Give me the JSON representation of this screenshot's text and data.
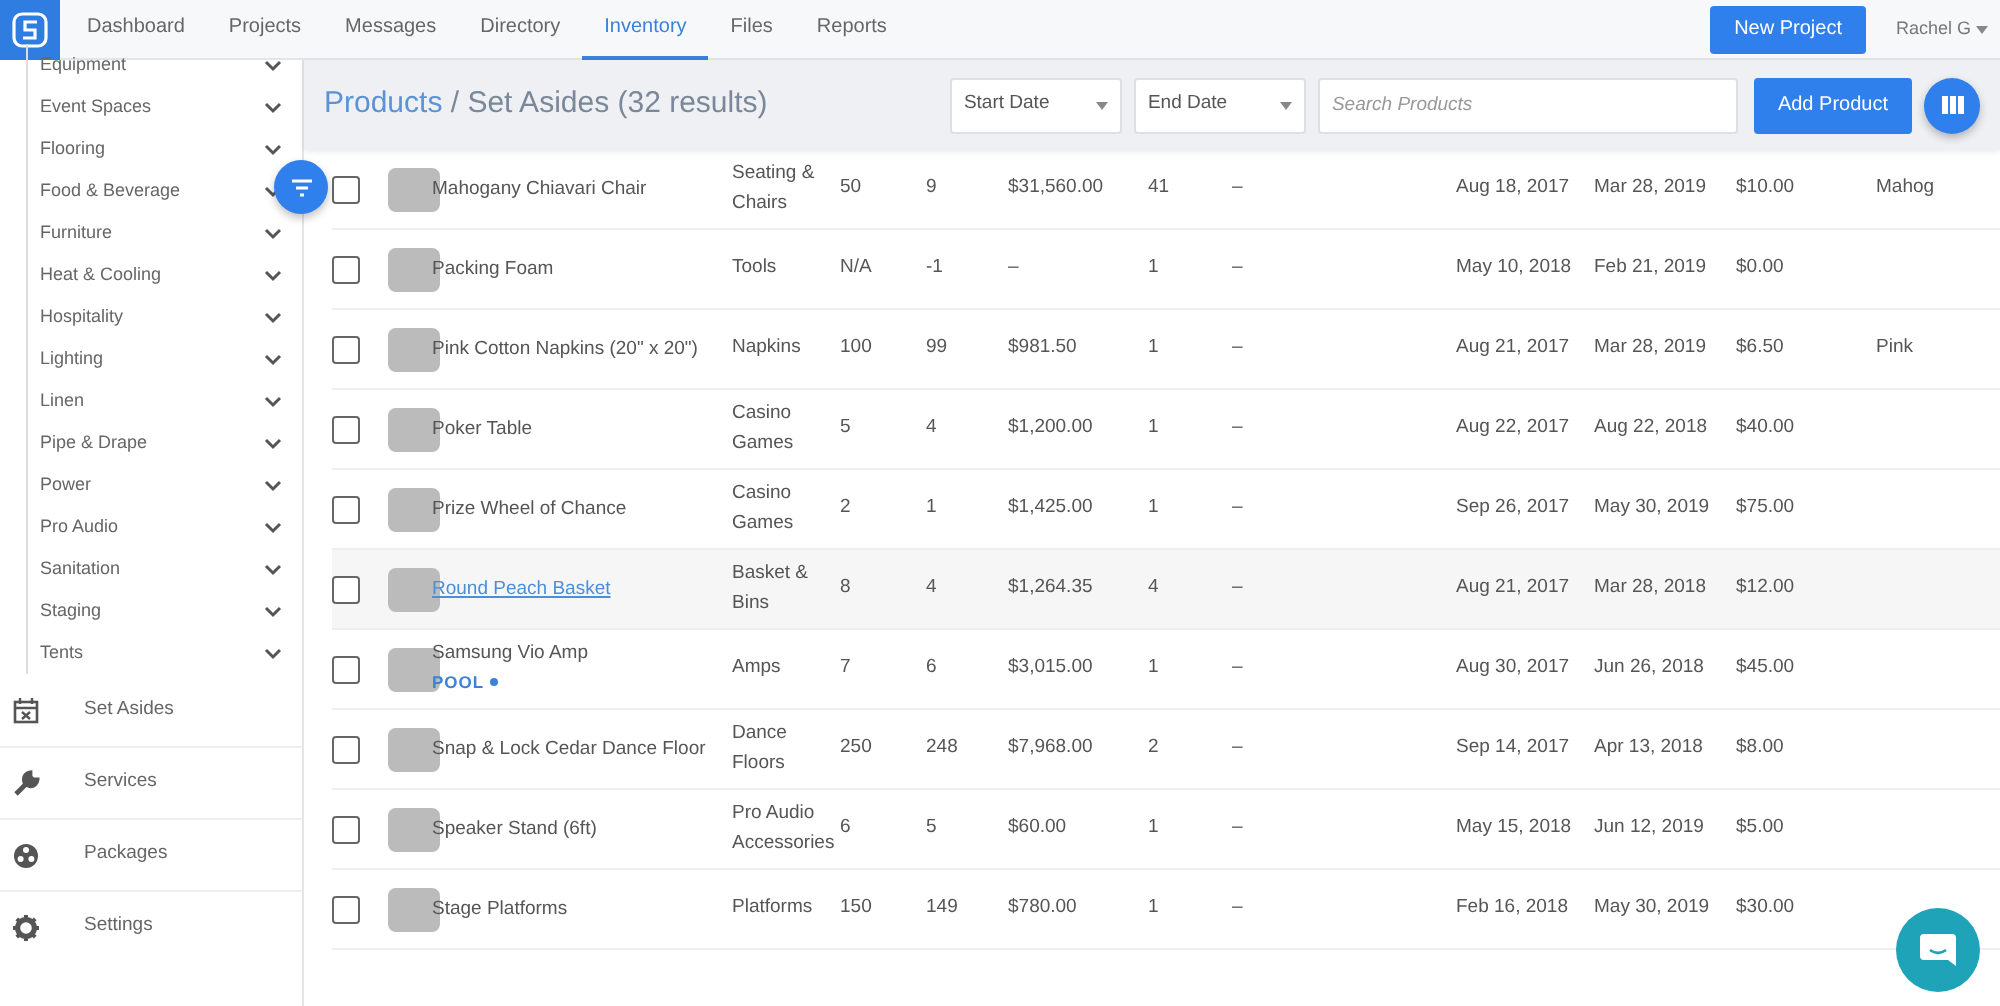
{
  "navbar": {
    "tabs": [
      {
        "label": "Dashboard",
        "selected": false
      },
      {
        "label": "Projects",
        "selected": false
      },
      {
        "label": "Messages",
        "selected": false
      },
      {
        "label": "Directory",
        "selected": false
      },
      {
        "label": "Inventory",
        "selected": true
      },
      {
        "label": "Files",
        "selected": false
      },
      {
        "label": "Reports",
        "selected": false
      }
    ],
    "new_project": "New Project",
    "user": "Rachel G"
  },
  "sidebar": {
    "categories": [
      "Equipment",
      "Event Spaces",
      "Flooring",
      "Food & Beverage",
      "Furniture",
      "Heat & Cooling",
      "Hospitality",
      "Lighting",
      "Linen",
      "Pipe & Drape",
      "Power",
      "Pro Audio",
      "Sanitation",
      "Staging",
      "Tents"
    ],
    "items": [
      {
        "label": "Set Asides",
        "kind": "calendar"
      },
      {
        "label": "Services",
        "kind": "wrench"
      },
      {
        "label": "Packages",
        "kind": "packages"
      },
      {
        "label": "Settings",
        "kind": "gear"
      }
    ]
  },
  "header": {
    "breadcrumb_link": "Products",
    "title": "/ Set Asides (32 results)",
    "start_date": {
      "placeholder": "Start Date"
    },
    "end_date": {
      "placeholder": "End Date"
    },
    "search": {
      "placeholder": "Search Products"
    },
    "add_product": "Add Product"
  },
  "table": {
    "rows": [
      {
        "name": "Mahogany Chiavari Chair",
        "checked": false,
        "hovered": false,
        "cells": [
          "Seating & Chairs",
          "50",
          "9",
          "$31,560.00",
          "41",
          "–",
          "Aug 18, 2017",
          "Mar 28, 2019",
          "$10.00",
          "Mahog"
        ]
      },
      {
        "name": "Packing Foam",
        "checked": false,
        "hovered": false,
        "cells": [
          "Tools",
          "N/A",
          "-1",
          "–",
          "1",
          "–",
          "May 10, 2018",
          "Feb 21, 2019",
          "$0.00",
          ""
        ]
      },
      {
        "name": "Pink Cotton Napkins (20\" x 20\")",
        "checked": false,
        "hovered": false,
        "cells": [
          "Napkins",
          "100",
          "99",
          "$981.50",
          "1",
          "–",
          "Aug 21, 2017",
          "Mar 28, 2019",
          "$6.50",
          "Pink"
        ]
      },
      {
        "name": "Poker Table",
        "checked": false,
        "hovered": false,
        "cells": [
          "Casino Games",
          "5",
          "4",
          "$1,200.00",
          "1",
          "–",
          "Aug 22, 2017",
          "Aug 22, 2018",
          "$40.00",
          ""
        ]
      },
      {
        "name": "Prize Wheel of Chance",
        "checked": false,
        "hovered": false,
        "cells": [
          "Casino Games",
          "2",
          "1",
          "$1,425.00",
          "1",
          "–",
          "Sep 26, 2017",
          "May 30, 2019",
          "$75.00",
          ""
        ]
      },
      {
        "name": "Round Peach Basket",
        "checked": false,
        "hovered": true,
        "cells": [
          "Basket & Bins",
          "8",
          "4",
          "$1,264.35",
          "4",
          "–",
          "Aug 21, 2017",
          "Mar 28, 2018",
          "$12.00",
          ""
        ]
      },
      {
        "name": "Samsung Vio Amp",
        "tag": "POOL",
        "checked": false,
        "hovered": false,
        "cells": [
          "Amps",
          "7",
          "6",
          "$3,015.00",
          "1",
          "–",
          "Aug 30, 2017",
          "Jun 26, 2018",
          "$45.00",
          ""
        ]
      },
      {
        "name": "Snap & Lock Cedar Dance Floor",
        "checked": false,
        "hovered": false,
        "cells": [
          "Dance Floors",
          "250",
          "248",
          "$7,968.00",
          "2",
          "–",
          "Sep 14, 2017",
          "Apr 13, 2018",
          "$8.00",
          ""
        ]
      },
      {
        "name": "Speaker Stand (6ft)",
        "checked": false,
        "hovered": false,
        "cells": [
          "Pro Audio Accessories",
          "6",
          "5",
          "$60.00",
          "1",
          "–",
          "May 15, 2018",
          "Jun 12, 2019",
          "$5.00",
          ""
        ]
      },
      {
        "name": "Stage Platforms",
        "checked": false,
        "hovered": false,
        "cells": [
          "Platforms",
          "150",
          "149",
          "$780.00",
          "1",
          "–",
          "Feb 16, 2018",
          "May 30, 2019",
          "$30.00",
          ""
        ]
      }
    ]
  }
}
